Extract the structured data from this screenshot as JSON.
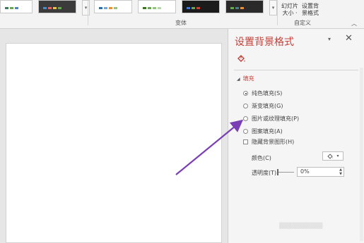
{
  "ribbon": {
    "group_variants_label": "变体",
    "group_custom_label": "自定义",
    "slide_size_label_line1": "幻灯片",
    "slide_size_label_line2": "大小 ·",
    "format_bg_label_line1": "设置背",
    "format_bg_label_line2": "景格式",
    "theme_thumbnails": [
      {
        "dots": [
          "#3a7d5c",
          "#6aa84f",
          "#4a86c5"
        ]
      },
      {
        "dots": [
          "#3f8fd2",
          "#e06666",
          "#f1c232",
          "#6aa84f"
        ]
      },
      {
        "dots": [
          "#2f6fb0",
          "#6fa8dc",
          "#e69138",
          "#93c47d"
        ]
      },
      {
        "dots": [
          "#38761d",
          "#6aa84f",
          "#93c47d",
          "#b6d7a8"
        ]
      },
      {
        "dots": [
          "#1b1b1b",
          "#3c78d8",
          "#6aa84f",
          "#cc4125"
        ]
      },
      {
        "dots": [
          "#2a2a2a",
          "#6aa84f",
          "#45818e",
          "#e69138"
        ]
      }
    ]
  },
  "pane": {
    "title": "设置背景格式",
    "section_fill": "填充",
    "options": [
      {
        "label": "纯色填充(S)",
        "selected": true
      },
      {
        "label": "渐变填充(G)",
        "selected": false
      },
      {
        "label": "图片或纹理填充(P)",
        "selected": false
      },
      {
        "label": "图案填充(A)",
        "selected": false
      }
    ],
    "hide_bg_graphics": "隐藏背景图形(H)",
    "color_label": "颜色(C)",
    "transparency_label": "透明度(T)",
    "transparency_value": "0%"
  },
  "colors": {
    "accent": "#c2413a",
    "arrow": "#7b3fb5"
  }
}
